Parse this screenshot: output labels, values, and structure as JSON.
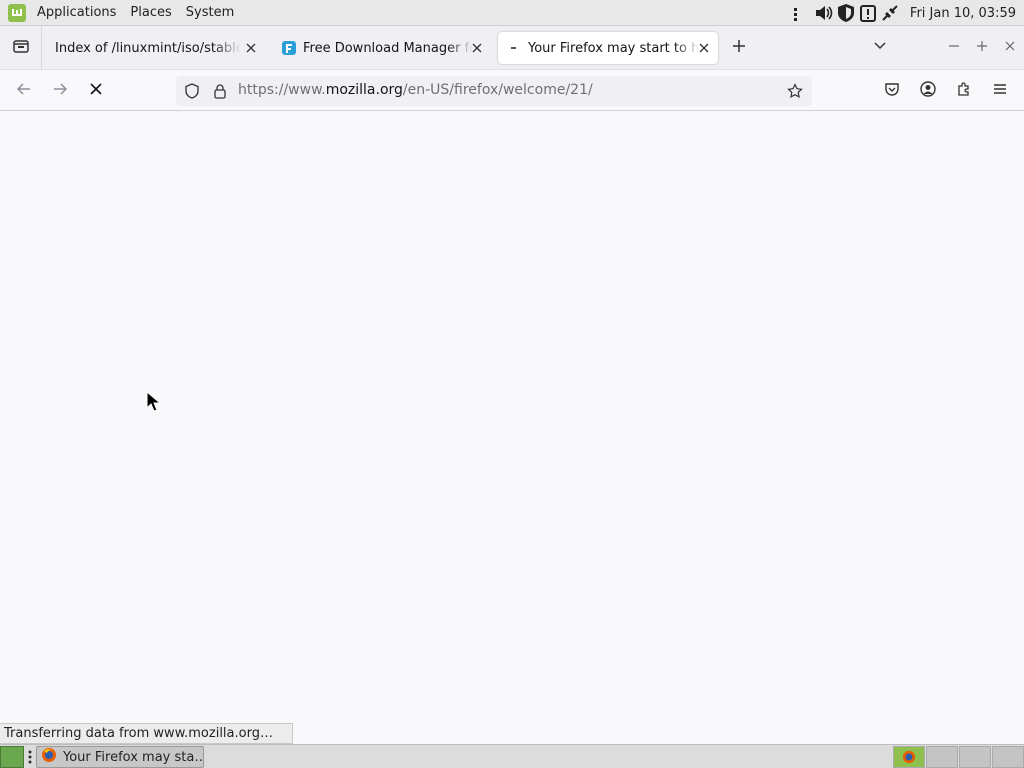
{
  "top_panel": {
    "menus": [
      "Applications",
      "Places",
      "System"
    ],
    "clock": "Fri Jan 10, 03:59"
  },
  "tabs": [
    {
      "title": "Index of /linuxmint/iso/stable/",
      "active": false
    },
    {
      "title": "Free Download Manager for",
      "active": false
    },
    {
      "title": "Your Firefox may start to ha",
      "active": true
    }
  ],
  "url": {
    "prefix": "https://www.",
    "domain": "mozilla.org",
    "path": "/en-US/firefox/welcome/21/"
  },
  "status": "Transferring data from www.mozilla.org…",
  "taskbar": {
    "window_label": "Your Firefox may sta…"
  },
  "colors": {
    "mint_green": "#8fbf4c",
    "page_bg": "#f9f9fb"
  }
}
